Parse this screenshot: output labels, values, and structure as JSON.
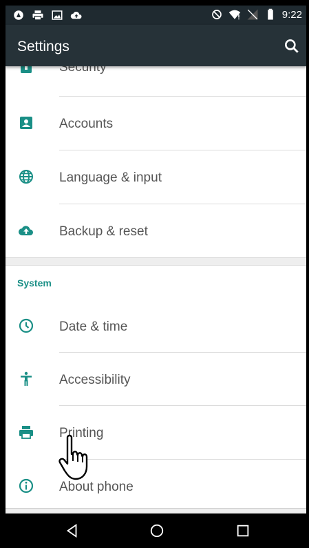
{
  "status_bar": {
    "time": "9:22",
    "left_icons": [
      "app-notification-icon",
      "print-notification-icon",
      "image-notification-icon",
      "cloud-upload-icon"
    ],
    "right_icons": [
      "do-not-disturb-icon",
      "wifi-icon",
      "no-sim-icon",
      "battery-icon"
    ]
  },
  "app_bar": {
    "title": "Settings",
    "search_icon": "search-icon"
  },
  "colors": {
    "accent": "#1a8f86",
    "app_bar": "#263238",
    "status_bar": "#1f2a30",
    "label_text": "#555555"
  },
  "list": {
    "partial_item": {
      "label": "Security",
      "icon": "security-icon"
    },
    "personal_items": [
      {
        "label": "Accounts",
        "icon": "accounts-icon"
      },
      {
        "label": "Language & input",
        "icon": "globe-icon"
      },
      {
        "label": "Backup & reset",
        "icon": "cloud-upload-icon"
      }
    ],
    "system_section": {
      "header": "System",
      "items": [
        {
          "label": "Date & time",
          "icon": "clock-icon"
        },
        {
          "label": "Accessibility",
          "icon": "accessibility-icon"
        },
        {
          "label": "Printing",
          "icon": "printer-icon"
        },
        {
          "label": "About phone",
          "icon": "info-icon"
        }
      ]
    }
  },
  "nav_bar": {
    "buttons": [
      "back-icon",
      "home-icon",
      "recents-icon"
    ]
  }
}
